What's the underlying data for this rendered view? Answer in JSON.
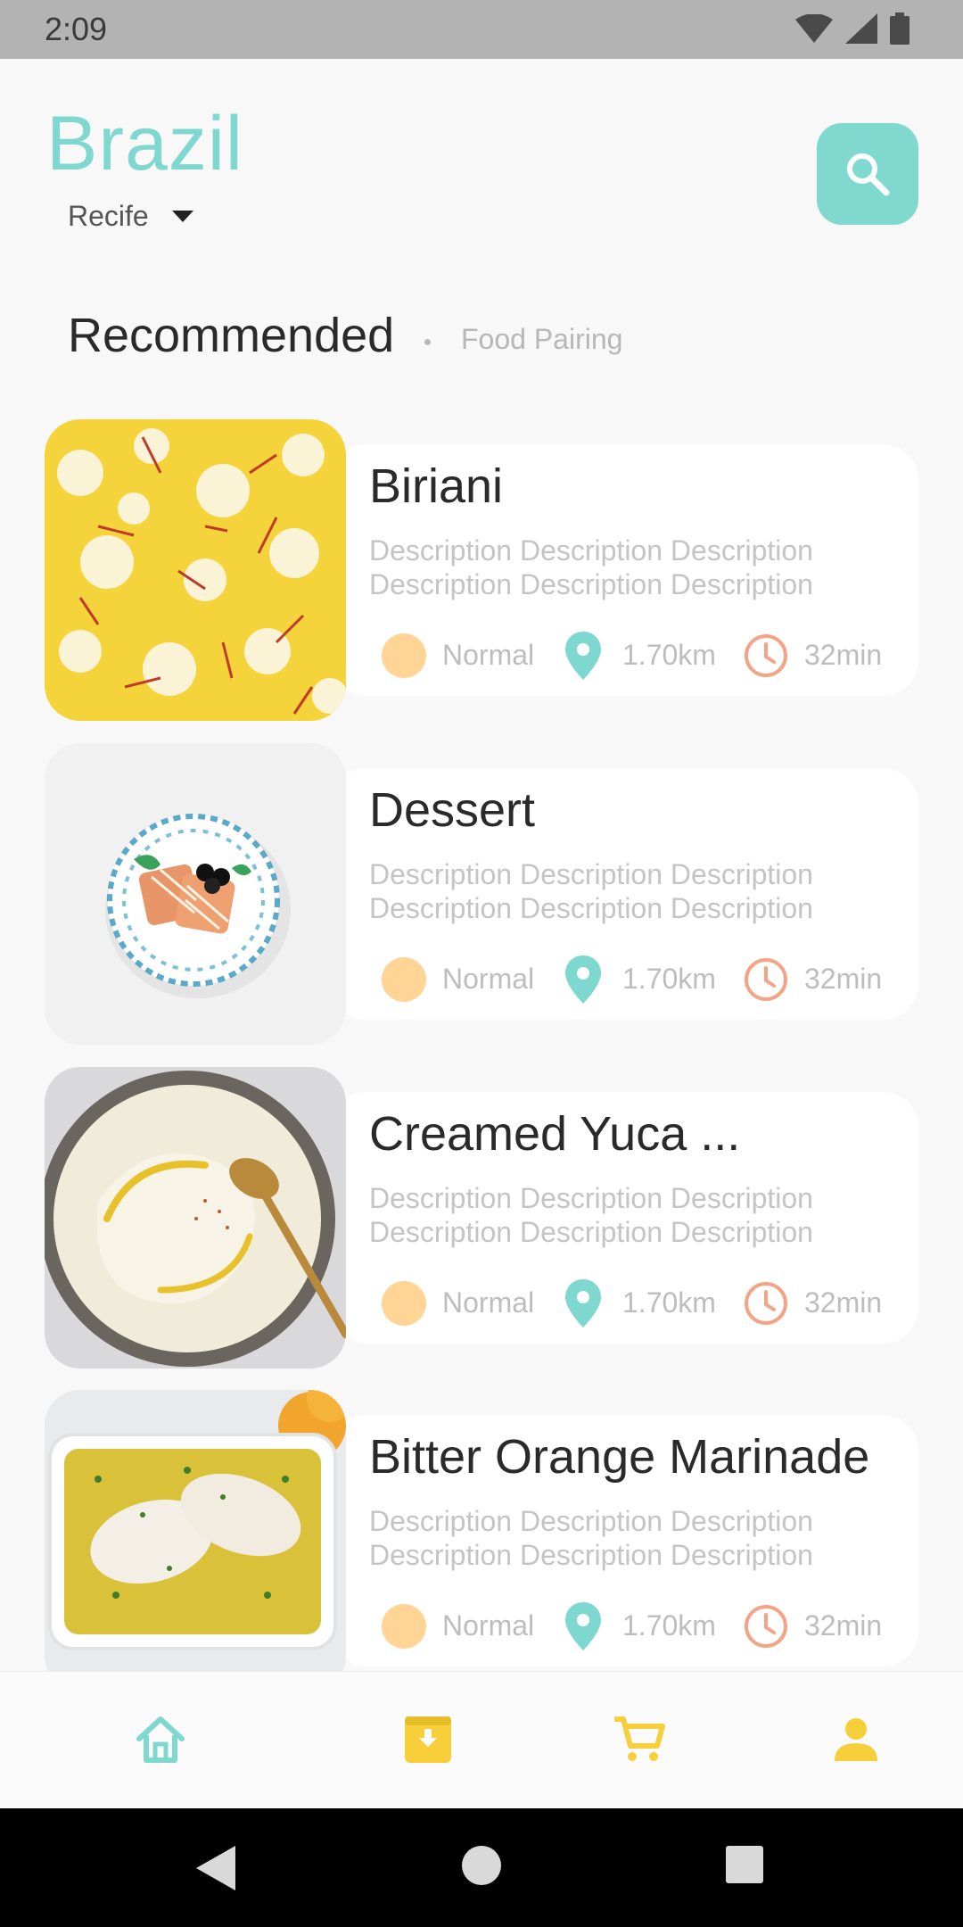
{
  "status_bar": {
    "time": "2:09",
    "icons": [
      "wifi-icon",
      "signal-icon",
      "battery-icon"
    ]
  },
  "header": {
    "country": "Brazil",
    "city": "Recife",
    "search_icon": "search-icon"
  },
  "tabs": {
    "active": "Recommended",
    "secondary": "Food Pairing"
  },
  "cards": [
    {
      "title": "Biriani",
      "description": "Description Description Description Description Description Description",
      "level": "Normal",
      "distance": "1.70km",
      "time": "32min",
      "image": "saffron-rice"
    },
    {
      "title": "Dessert",
      "description": "Description Description Description Description Description Description",
      "level": "Normal",
      "distance": "1.70km",
      "time": "32min",
      "image": "waffle-plate"
    },
    {
      "title": "Creamed Yuca ...",
      "description": "Description Description Description Description Description Description",
      "level": "Normal",
      "distance": "1.70km",
      "time": "32min",
      "image": "creamed-yuca-bowl"
    },
    {
      "title": "Bitter Orange Marinade",
      "description": "Description Description Description Description Description Description",
      "level": "Normal",
      "distance": "1.70km",
      "time": "32min",
      "image": "marinated-chicken-dish"
    }
  ],
  "bottom_nav": {
    "items": [
      "home-icon",
      "archive-icon",
      "cart-icon",
      "profile-icon"
    ],
    "active": "home-icon"
  },
  "colors": {
    "accent": "#80d9cf",
    "level_dot": "#ffd596",
    "pin": "#7fd8cf",
    "clock": "#f4a486",
    "nav_yellow": "#f7cf3a"
  }
}
